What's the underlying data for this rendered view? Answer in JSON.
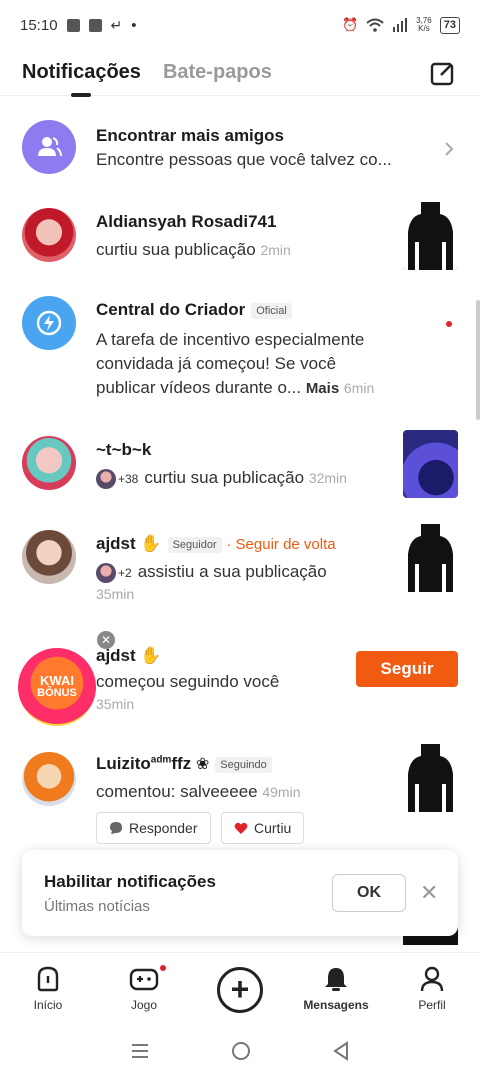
{
  "status_bar": {
    "time": "15:10",
    "dot": "•",
    "battery": "73",
    "net_top": "3,76",
    "net_bottom": "K/s"
  },
  "tabs": {
    "notifications": "Notificações",
    "chats": "Bate-papos"
  },
  "rows": {
    "find_friends": {
      "title": "Encontrar mais amigos",
      "subtitle": "Encontre pessoas que você talvez co..."
    },
    "aldiansyah": {
      "name": "Aldiansyah Rosadi741",
      "action": "curtiu sua publicação",
      "time": "2min"
    },
    "criador": {
      "name": "Central do Criador",
      "badge": "Oficial",
      "text_1": "A tarefa de incentivo especialmente",
      "text_2": "convidada já começou! Se você",
      "text_3": "publicar vídeos durante o...",
      "more": "Mais",
      "time": "6min"
    },
    "tbk": {
      "name": "~t~b~k",
      "count": "+38",
      "action": "curtiu sua publicação",
      "time": "32min"
    },
    "ajdst_1": {
      "name": "ajdst",
      "badge": "Seguidor",
      "follow_back": "· Seguir de volta",
      "count": "+2",
      "action": "assistiu a sua publicação",
      "time": "35min"
    },
    "ajdst_2": {
      "name": "ajdst",
      "action": "começou seguindo você",
      "time": "35min",
      "button": "Seguir"
    },
    "luizito": {
      "name": "Luizito",
      "sup": "adm",
      "name_tail": "ffz",
      "badge": "Seguindo",
      "action": "comentou: salveeeee",
      "time": "49min",
      "reply": "Responder",
      "liked": "Curtiu"
    }
  },
  "kwai_bonus": {
    "line1": "KWAI",
    "line2": "BÔNUS"
  },
  "toast": {
    "title": "Habilitar notificações",
    "subtitle": "Últimas notícias",
    "ok": "OK"
  },
  "bottom_nav": {
    "home": "Início",
    "game": "Jogo",
    "messages": "Mensagens",
    "profile": "Perfil"
  },
  "colors": {
    "accent": "#f15a11",
    "follow_text": "#f15a11",
    "find_friends_avatar": "#8e7bf0",
    "creator_avatar": "#4aa5f0",
    "unread_dot": "#e0242b"
  }
}
